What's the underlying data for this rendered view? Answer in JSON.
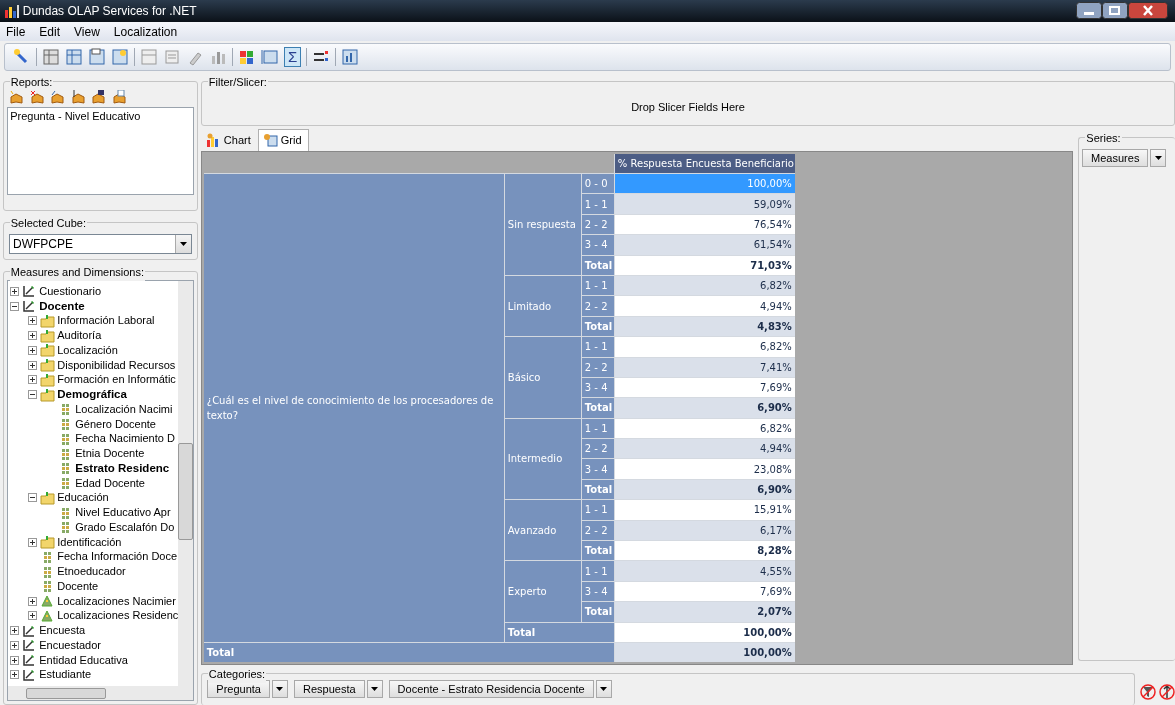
{
  "window": {
    "title": "Dundas OLAP Services for .NET"
  },
  "menu": [
    "File",
    "Edit",
    "View",
    "Localization"
  ],
  "toolbar": {
    "sum_label": "Σ",
    "sum_pressed": true
  },
  "reports": {
    "label": "Reports:",
    "items": [
      "Pregunta - Nivel Educativo"
    ]
  },
  "selected_cube": {
    "label": "Selected Cube:",
    "value": "DWFPCPE"
  },
  "measures_tree": {
    "label": "Measures and Dimensions:",
    "items": [
      {
        "label": "Cuestionario",
        "kind": "dimension",
        "expanded": false,
        "in_use": false
      },
      {
        "label": "Docente",
        "kind": "dimension",
        "expanded": true,
        "in_use": true,
        "children": [
          {
            "label": "Información Laboral",
            "kind": "folder",
            "expanded": false,
            "in_use": false
          },
          {
            "label": "Auditoría",
            "kind": "folder",
            "expanded": false,
            "in_use": false
          },
          {
            "label": "Localización",
            "kind": "folder",
            "expanded": false,
            "in_use": false
          },
          {
            "label": "Disponibilidad Recursos",
            "kind": "folder",
            "expanded": false,
            "in_use": false
          },
          {
            "label": "Formación en Informátic",
            "kind": "folder",
            "expanded": false,
            "in_use": false
          },
          {
            "label": "Demográfica",
            "kind": "folder",
            "expanded": true,
            "in_use": true,
            "children": [
              {
                "label": "Localización Nacimi",
                "kind": "attribute",
                "in_use": false
              },
              {
                "label": "Género Docente",
                "kind": "attribute",
                "in_use": false
              },
              {
                "label": "Fecha Nacimiento D",
                "kind": "attribute",
                "in_use": false
              },
              {
                "label": "Etnia Docente",
                "kind": "attribute",
                "in_use": false
              },
              {
                "label": "Estrato Residenc",
                "kind": "attribute",
                "in_use": true
              },
              {
                "label": "Edad Docente",
                "kind": "attribute",
                "in_use": false
              }
            ]
          },
          {
            "label": "Educación",
            "kind": "folder",
            "expanded": true,
            "in_use": false,
            "children": [
              {
                "label": "Nivel Educativo Apr",
                "kind": "attribute",
                "in_use": false
              },
              {
                "label": "Grado Escalafón Do",
                "kind": "attribute",
                "in_use": false
              }
            ]
          },
          {
            "label": "Identificación",
            "kind": "folder",
            "expanded": false,
            "in_use": false
          },
          {
            "label": "Fecha Información Doce",
            "kind": "attribute",
            "in_use": false
          },
          {
            "label": "Etnoeducador",
            "kind": "attribute",
            "in_use": false
          },
          {
            "label": "Docente",
            "kind": "attribute",
            "in_use": false
          },
          {
            "label": "Localizaciones Nacimier",
            "kind": "hierarchy",
            "expanded": false,
            "in_use": false
          },
          {
            "label": "Localizaciones Residenc",
            "kind": "hierarchy",
            "expanded": false,
            "in_use": false
          }
        ]
      },
      {
        "label": "Encuesta",
        "kind": "dimension",
        "expanded": false,
        "in_use": false
      },
      {
        "label": "Encuestador",
        "kind": "dimension",
        "expanded": false,
        "in_use": false
      },
      {
        "label": "Entidad Educativa",
        "kind": "dimension",
        "expanded": false,
        "in_use": false
      },
      {
        "label": "Estudiante",
        "kind": "dimension",
        "expanded": false,
        "in_use": false
      }
    ]
  },
  "filter": {
    "label": "Filter/Slicer:",
    "hint": "Drop Slicer Fields Here"
  },
  "tabs": [
    {
      "label": "Chart",
      "selected": false
    },
    {
      "label": "Grid",
      "selected": true
    }
  ],
  "grid": {
    "column_header": "% Respuesta Encuesta Beneficiario",
    "question": "¿Cuál es el nivel de conocimiento de los procesadores de texto?",
    "groups": [
      {
        "label": "Sin respuesta",
        "rows": [
          {
            "label": "0 - 0",
            "value": "100,00%",
            "kind": "item",
            "selected": true
          },
          {
            "label": "1 - 1",
            "value": "59,09%",
            "kind": "item",
            "selected": false
          },
          {
            "label": "2 - 2",
            "value": "76,54%",
            "kind": "item",
            "selected": false
          },
          {
            "label": "3 - 4",
            "value": "61,54%",
            "kind": "item",
            "selected": false
          },
          {
            "label": "Total",
            "value": "71,03%",
            "kind": "total",
            "selected": false
          }
        ]
      },
      {
        "label": "Limitado",
        "rows": [
          {
            "label": "1 - 1",
            "value": "6,82%",
            "kind": "item",
            "selected": false
          },
          {
            "label": "2 - 2",
            "value": "4,94%",
            "kind": "item",
            "selected": false
          },
          {
            "label": "Total",
            "value": "4,83%",
            "kind": "total",
            "selected": false
          }
        ]
      },
      {
        "label": "Básico",
        "rows": [
          {
            "label": "1 - 1",
            "value": "6,82%",
            "kind": "item",
            "selected": false
          },
          {
            "label": "2 - 2",
            "value": "7,41%",
            "kind": "item",
            "selected": false
          },
          {
            "label": "3 - 4",
            "value": "7,69%",
            "kind": "item",
            "selected": false
          },
          {
            "label": "Total",
            "value": "6,90%",
            "kind": "total",
            "selected": false
          }
        ]
      },
      {
        "label": "Intermedio",
        "rows": [
          {
            "label": "1 - 1",
            "value": "6,82%",
            "kind": "item",
            "selected": false
          },
          {
            "label": "2 - 2",
            "value": "4,94%",
            "kind": "item",
            "selected": false
          },
          {
            "label": "3 - 4",
            "value": "23,08%",
            "kind": "item",
            "selected": false
          },
          {
            "label": "Total",
            "value": "6,90%",
            "kind": "total",
            "selected": false
          }
        ]
      },
      {
        "label": "Avanzado",
        "rows": [
          {
            "label": "1 - 1",
            "value": "15,91%",
            "kind": "item",
            "selected": false
          },
          {
            "label": "2 - 2",
            "value": "6,17%",
            "kind": "item",
            "selected": false
          },
          {
            "label": "Total",
            "value": "8,28%",
            "kind": "total",
            "selected": false
          }
        ]
      },
      {
        "label": "Experto",
        "rows": [
          {
            "label": "1 - 1",
            "value": "4,55%",
            "kind": "item",
            "selected": false
          },
          {
            "label": "3 - 4",
            "value": "7,69%",
            "kind": "item",
            "selected": false
          },
          {
            "label": "Total",
            "value": "2,07%",
            "kind": "total",
            "selected": false
          }
        ]
      }
    ],
    "question_total": {
      "label": "Total",
      "value": "100,00%"
    },
    "grand_total": {
      "label": "Total",
      "value": "100,00%"
    }
  },
  "series": {
    "label": "Series:",
    "fields": [
      "Measures"
    ]
  },
  "categories": {
    "label": "Categories:",
    "fields": [
      "Pregunta",
      "Respuesta",
      "Docente - Estrato Residencia Docente"
    ]
  }
}
